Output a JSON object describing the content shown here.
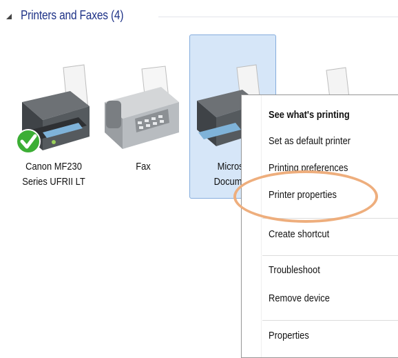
{
  "section": {
    "title": "Printers and Faxes (4)"
  },
  "devices": [
    {
      "label_line1": "Canon MF230",
      "label_line2": "Series UFRII LT",
      "default": true
    },
    {
      "label_line1": "Fax",
      "label_line2": ""
    },
    {
      "label_line1": "Microsof",
      "label_line2": "Document",
      "selected": true
    },
    {
      "label_line1": "",
      "label_line2": ""
    }
  ],
  "context_menu": {
    "items": [
      {
        "label": "See what's printing",
        "bold": true
      },
      {
        "label": "Set as default printer"
      },
      {
        "label": "Printing preferences"
      },
      {
        "label": "Printer properties"
      },
      {
        "label": "Create shortcut"
      },
      {
        "label": "Troubleshoot"
      },
      {
        "label": "Remove device"
      },
      {
        "label": "Properties"
      }
    ]
  },
  "colors": {
    "section_title": "#1e3287",
    "selection_fill": "#d6e6f8",
    "selection_border": "#84acdd",
    "highlight_ring": "#eeae7d",
    "check_green": "#3cae35"
  },
  "icons": [
    "collapse-arrow-icon",
    "printer-icon",
    "fax-icon",
    "default-check-icon"
  ]
}
